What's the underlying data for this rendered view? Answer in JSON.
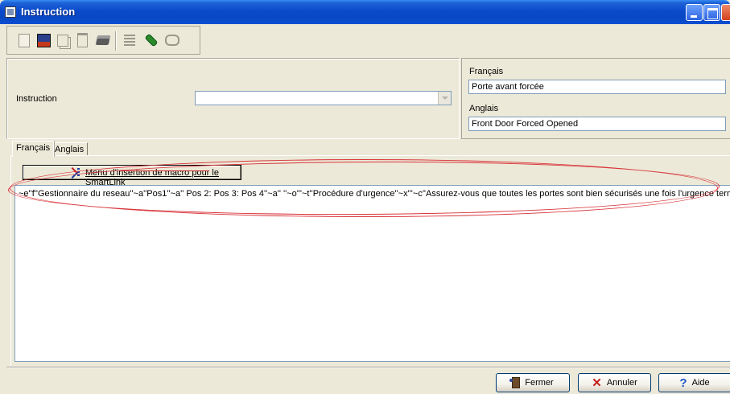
{
  "window": {
    "title": "Instruction"
  },
  "toolbar": {
    "icons": [
      "new-icon",
      "save-icon",
      "copy-icon",
      "delete-icon",
      "print-icon",
      "list-icon",
      "link-icon",
      "search-icon"
    ]
  },
  "form": {
    "instruction_label": "Instruction",
    "instruction_value": "",
    "francais_label": "Français",
    "francais_value": "Porte avant forcée",
    "anglais_label": "Anglais",
    "anglais_value": "Front Door Forced Opened"
  },
  "tabs": [
    {
      "label": "Français",
      "selected": true
    },
    {
      "label": "Anglais",
      "selected": false
    }
  ],
  "macro_button": {
    "label": "Menu d'insertion de macro pour le SmartLink"
  },
  "editor": {
    "text": "~e''f''Gestionnaire du reseau''~a''Pos1''~a'' Pos 2: Pos 3: Pos 4''~a'' ''~o'''~t''Procédure d'urgence''~x'''~c''Assurez-vous que toutes les portes sont bien sécurisés une fois l'urgence terminée.''~s"
  },
  "buttons": {
    "fermer": "Fermer",
    "annuler": "Annuler",
    "aide": "Aide"
  },
  "colors": {
    "titlebar": "#0A4ACB",
    "window_bg": "#ECE9D8",
    "annotation": "#D8343A"
  }
}
